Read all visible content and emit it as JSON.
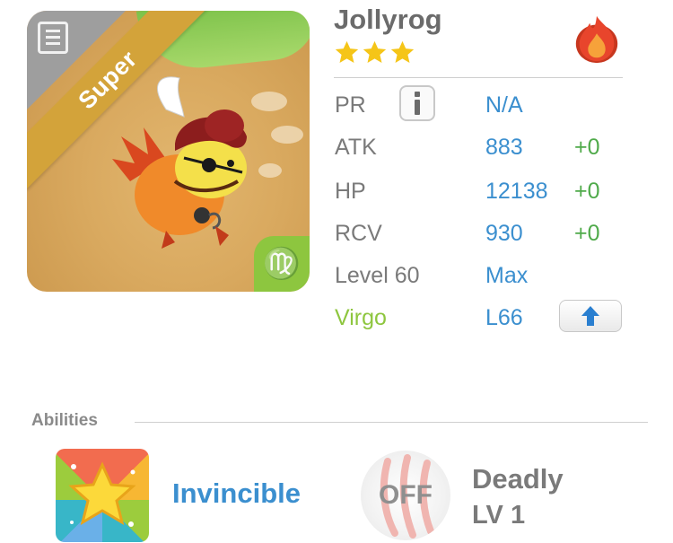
{
  "monster": {
    "name": "Jollyrog",
    "stars": 3,
    "rarity_banner": "Super",
    "element_icon": "fire-icon",
    "zodiac_symbol": "♍"
  },
  "stats": {
    "pr": {
      "label": "PR",
      "value": "N/A"
    },
    "atk": {
      "label": "ATK",
      "value": "883",
      "bonus": "+0"
    },
    "hp": {
      "label": "HP",
      "value": "12138",
      "bonus": "+0"
    },
    "rcv": {
      "label": "RCV",
      "value": "930",
      "bonus": "+0"
    },
    "level": {
      "label": "Level 60",
      "value": "Max"
    },
    "zodiac": {
      "label": "Virgo",
      "value": "L66"
    }
  },
  "abilities": {
    "title": "Abilities",
    "first": {
      "name": "Invincible"
    },
    "second": {
      "status": "OFF",
      "name": "Deadly",
      "level": "LV 1"
    }
  },
  "colors": {
    "value_blue": "#3b8fcf",
    "bonus_green": "#4faa4a",
    "virgo_green": "#8ec63f",
    "rarity_gold": "#d3a33a",
    "star_gold": "#f5c518",
    "fire_red": "#e8452c"
  }
}
